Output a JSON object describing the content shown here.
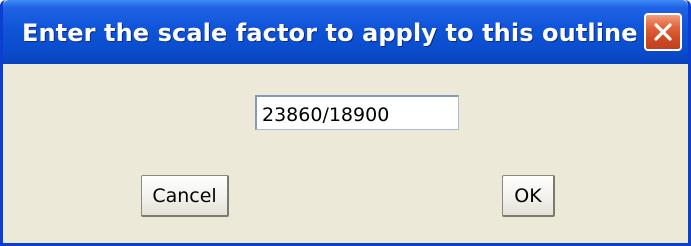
{
  "window": {
    "title": "Enter the scale factor to apply to this outline",
    "close_icon": "close-icon",
    "accent_color": "#0a4ccb"
  },
  "form": {
    "scale_value": "23860/18900"
  },
  "buttons": {
    "cancel_label": "Cancel",
    "ok_label": "OK"
  }
}
